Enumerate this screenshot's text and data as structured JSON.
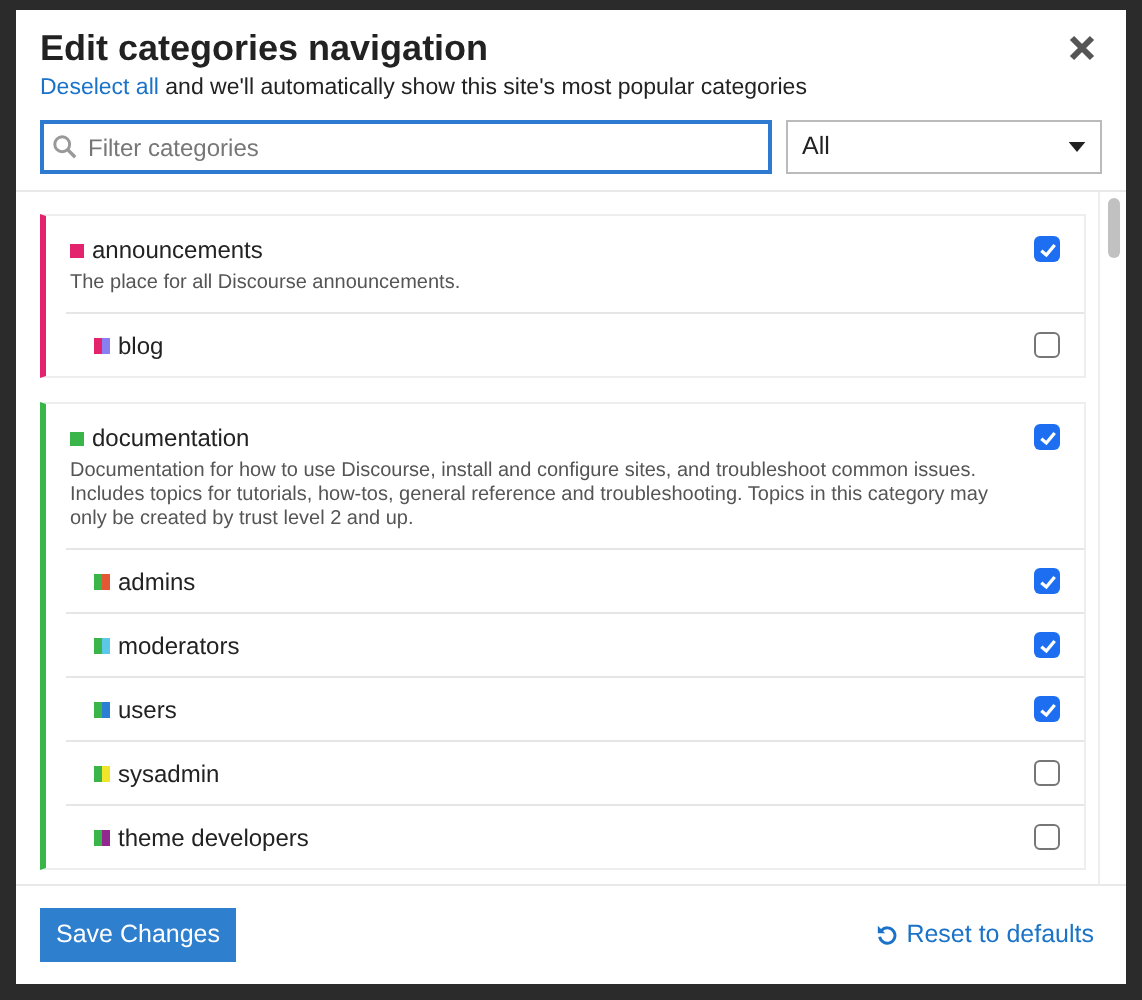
{
  "dialog": {
    "title": "Edit categories navigation",
    "hint_link": "Deselect all",
    "hint_text": "and we'll automatically show this site's most popular categories"
  },
  "filter": {
    "placeholder": "Filter categories"
  },
  "scope_select": {
    "value": "All"
  },
  "categories": [
    {
      "name": "announcements",
      "color": "#e3236d",
      "description": "The place for all Discourse announcements.",
      "checked": true,
      "children": [
        {
          "name": "blog",
          "color": "#8a7ff0",
          "checked": false
        }
      ]
    },
    {
      "name": "documentation",
      "color": "#3ab54a",
      "description": "Documentation for how to use Discourse, install and configure sites, and troubleshoot common issues. Includes topics for tutorials, how-tos, general reference and troubleshooting. Topics in this category may only be created by trust level 2 and up.",
      "checked": true,
      "children": [
        {
          "name": "admins",
          "color": "#e45735",
          "checked": true
        },
        {
          "name": "moderators",
          "color": "#5bc8e8",
          "checked": true
        },
        {
          "name": "users",
          "color": "#2a7fd4",
          "checked": true
        },
        {
          "name": "sysadmin",
          "color": "#f1e52a",
          "checked": false
        },
        {
          "name": "theme developers",
          "color": "#92278f",
          "checked": false
        }
      ]
    }
  ],
  "footer": {
    "save": "Save Changes",
    "reset": "Reset to defaults"
  }
}
